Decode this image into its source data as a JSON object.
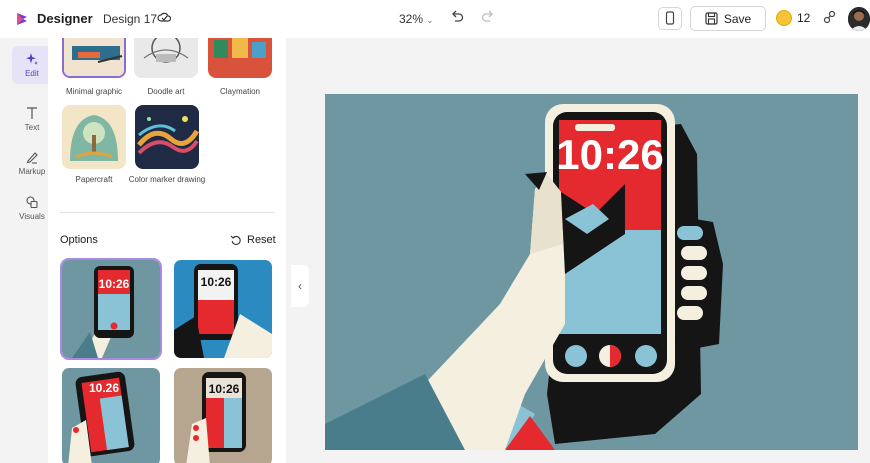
{
  "header": {
    "app_name": "Designer",
    "doc_name": "Design 17",
    "zoom": "32%",
    "save_label": "Save",
    "boosts": "12",
    "icons": [
      "designer-logo",
      "cloud-sync-icon",
      "undo-icon",
      "redo-icon",
      "device-icon",
      "save-icon",
      "coin-icon",
      "share-icon",
      "avatar"
    ]
  },
  "rail": {
    "items": [
      {
        "label": "Edit",
        "icon": "sparkle-icon"
      },
      {
        "label": "Text",
        "icon": "text-icon"
      },
      {
        "label": "Markup",
        "icon": "pen-icon"
      },
      {
        "label": "Visuals",
        "icon": "shapes-icon"
      }
    ]
  },
  "panel": {
    "styles": [
      {
        "label": "Minimal graphic"
      },
      {
        "label": "Doodle art"
      },
      {
        "label": "Claymation"
      },
      {
        "label": "Papercraft"
      },
      {
        "label": "Color marker drawing"
      }
    ],
    "options_title": "Options",
    "reset_label": "Reset",
    "option_times": [
      "10:26",
      "10:26",
      "10.26",
      "10:26"
    ]
  },
  "canvas": {
    "clock_text": "10:26"
  },
  "colors": {
    "accent": "#5b3fc6",
    "canvas_bg": "#6f97a2",
    "red": "#e52a2f",
    "light_blue": "#8ac3d6",
    "cream": "#f4efdf",
    "black": "#151515"
  }
}
